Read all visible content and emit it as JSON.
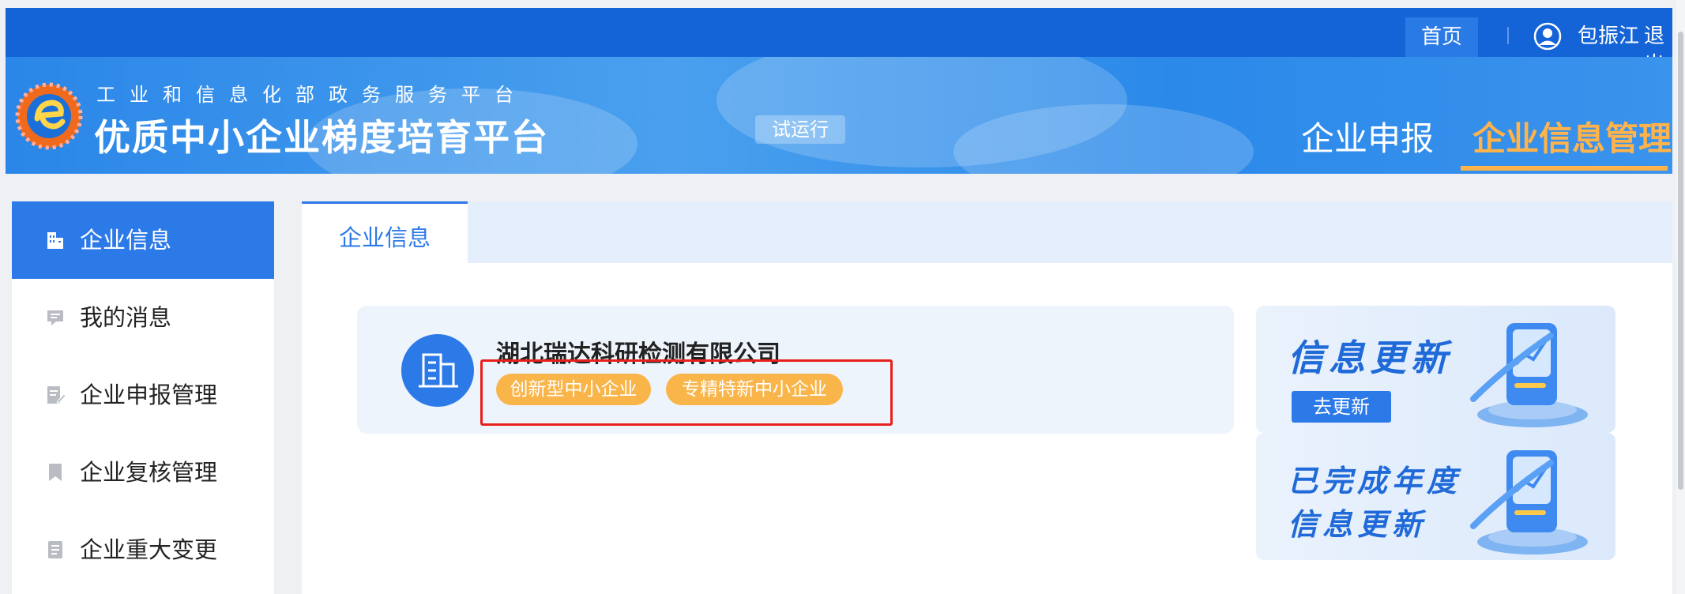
{
  "topbar": {
    "home": "首页",
    "user_name": "包振江",
    "logout": "退出"
  },
  "banner": {
    "sub_title": "工业和信息化部政务服务平台",
    "main_title": "优质中小企业梯度培育平台",
    "trial_badge": "试运行",
    "nav": [
      {
        "label": "企业申报"
      },
      {
        "label": "企业信息管理"
      }
    ],
    "active_color": "#ffb34a"
  },
  "sidebar": {
    "items": [
      {
        "label": "企业信息",
        "icon": "building-icon"
      },
      {
        "label": "我的消息",
        "icon": "message-icon"
      },
      {
        "label": "企业申报管理",
        "icon": "edit-document-icon"
      },
      {
        "label": "企业复核管理",
        "icon": "bookmark-icon"
      },
      {
        "label": "企业重大变更",
        "icon": "document-icon"
      }
    ],
    "accent": "#2c79e8"
  },
  "content": {
    "tab": "企业信息",
    "company": {
      "name": "湖北瑞达科研检测有限公司",
      "tags": [
        "创新型中小企业",
        "专精特新中小企业"
      ]
    },
    "promos": [
      {
        "title": "信息更新",
        "button": "去更新"
      },
      {
        "title_line1": "已完成年度",
        "title_line2": "信息更新"
      }
    ]
  }
}
